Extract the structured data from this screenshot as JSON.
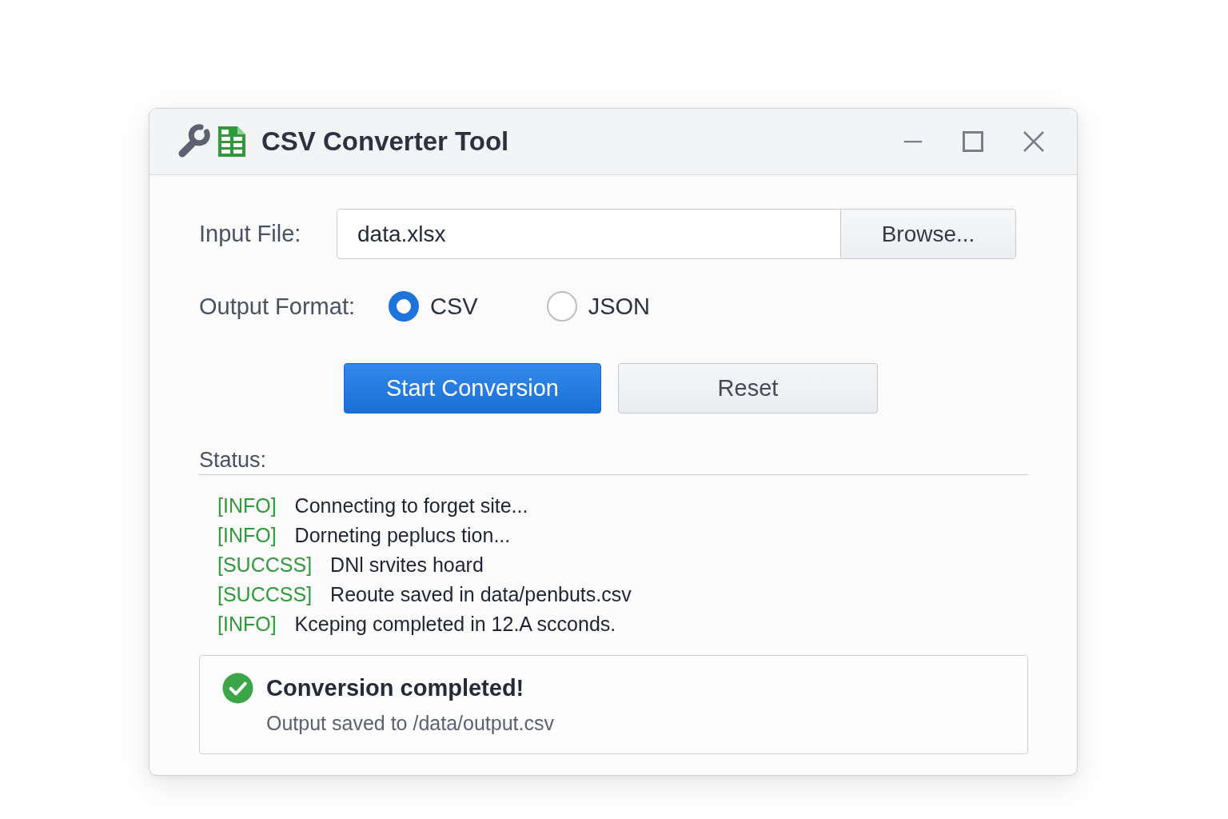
{
  "window": {
    "title": "CSV Converter Tool"
  },
  "input_file": {
    "label": "Input File:",
    "value": "data.xlsx",
    "browse_button": "Browse..."
  },
  "output_format": {
    "label": "Output Format:",
    "options": [
      {
        "label": "CSV",
        "selected": true
      },
      {
        "label": "JSON",
        "selected": false
      }
    ]
  },
  "buttons": [
    {
      "label": "Start Conversion",
      "kind": "primary"
    },
    {
      "label": "Reset",
      "kind": "secondary"
    }
  ],
  "status": {
    "label": "Status:",
    "log": [
      {
        "tag": "[INFO]",
        "message": "Connecting to forget site..."
      },
      {
        "tag": "[INFO]",
        "message": "Dorneting peplucs tion..."
      },
      {
        "tag": "[SUCCSS]",
        "message": "DNl srvites hoard"
      },
      {
        "tag": "[SUCCSS]",
        "message": "Reoute saved in data/penbuts.csv"
      },
      {
        "tag": "[INFO]",
        "message": "Kceping completed in 12.A scconds."
      }
    ]
  },
  "result": {
    "title": "Conversion completed!",
    "detail": "Output saved to /data/output.csv"
  }
}
